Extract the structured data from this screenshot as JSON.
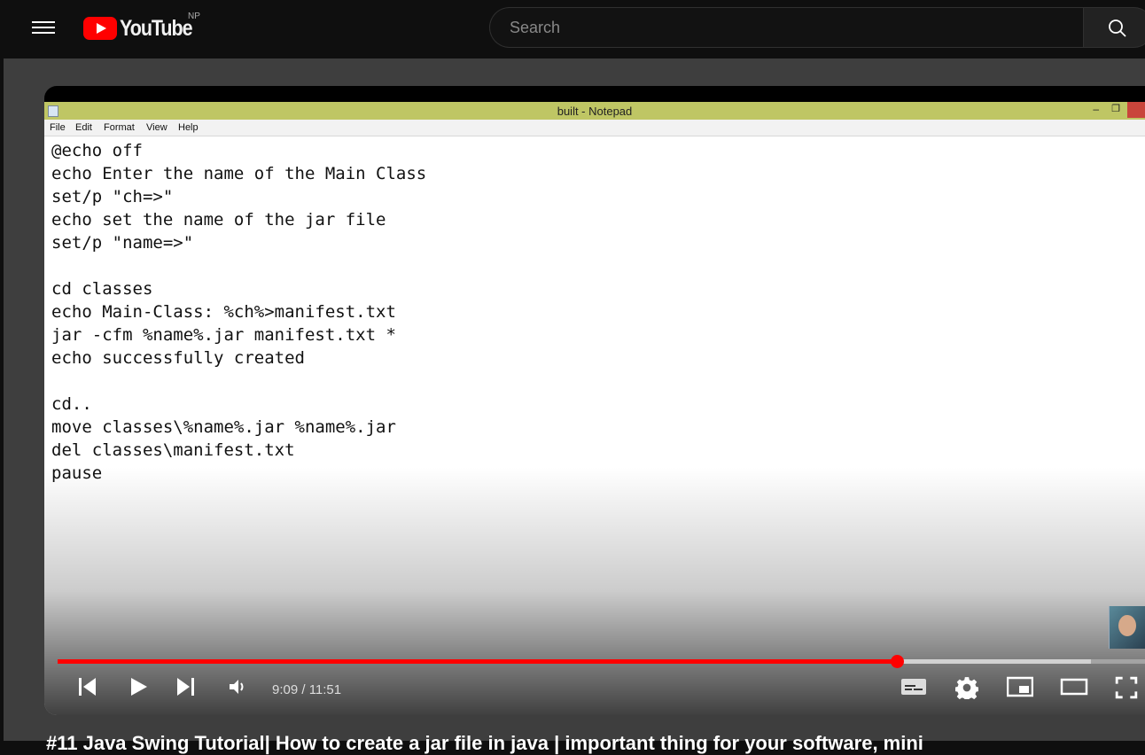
{
  "header": {
    "logo_text": "YouTube",
    "country_code": "NP",
    "search_placeholder": "Search"
  },
  "notepad": {
    "window_title": "built - Notepad",
    "menu": [
      "File",
      "Edit",
      "Format",
      "View",
      "Help"
    ],
    "content": "@echo off\necho Enter the name of the Main Class\nset/p \"ch=>\"\necho set the name of the jar file\nset/p \"name=>\"\n\ncd classes\necho Main-Class: %ch%>manifest.txt\njar -cfm %name%.jar manifest.txt *\necho successfully created\n\ncd..\nmove classes\\%name%.jar %name%.jar\ndel classes\\manifest.txt\npause"
  },
  "player": {
    "current_time": "9:09",
    "duration": "11:51",
    "time_display": "9:09 / 11:51",
    "played_fraction": 0.7715,
    "buffered_fraction": 0.95,
    "colors": {
      "progress": "#ff0000",
      "brand": "#ff0000"
    }
  },
  "video_title_partial": "#11 Java Swing Tutorial| How to create a jar file in java | important thing for your software, mini"
}
